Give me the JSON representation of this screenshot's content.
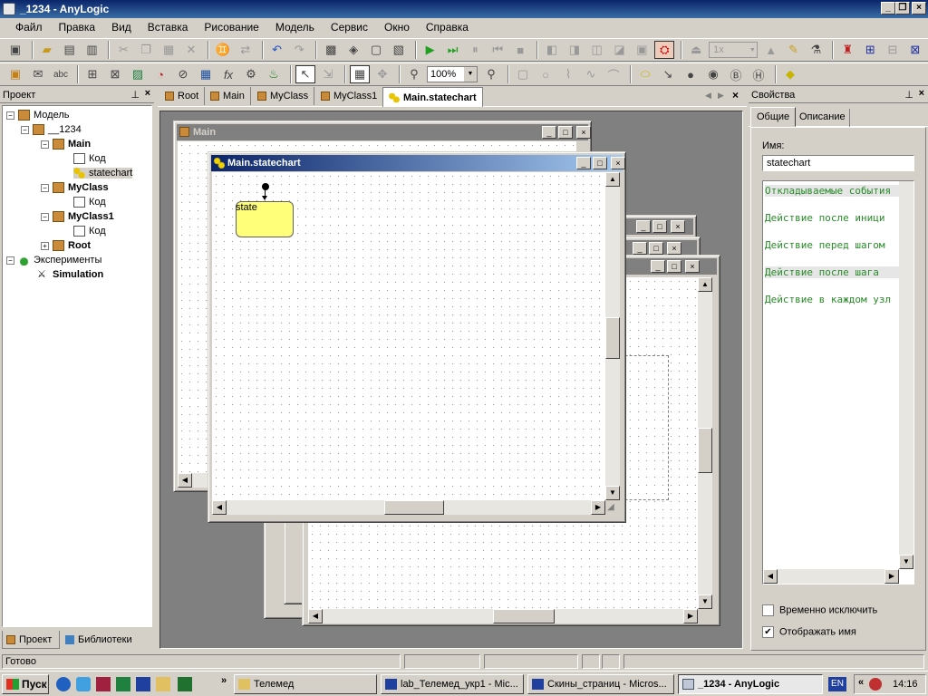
{
  "window": {
    "title": "_1234 - AnyLogic"
  },
  "menu": [
    "Файл",
    "Правка",
    "Вид",
    "Вставка",
    "Рисование",
    "Модель",
    "Сервис",
    "Окно",
    "Справка"
  ],
  "toolbar": {
    "speed": "1x",
    "zoom": "100%"
  },
  "project_panel": {
    "title": "Проект",
    "tree": {
      "model": "Модель",
      "project": "__1234",
      "main": "Main",
      "main_code": "Код",
      "main_statechart": "statechart",
      "myclass": "MyClass",
      "myclass_code": "Код",
      "myclass1": "MyClass1",
      "myclass1_code": "Код",
      "root": "Root",
      "experiments": "Эксперименты",
      "simulation": "Simulation"
    },
    "tabs": {
      "project": "Проект",
      "libraries": "Библиотеки"
    }
  },
  "editor_tabs": [
    "Root",
    "Main",
    "MyClass",
    "MyClass1",
    "Main.statechart"
  ],
  "windows": {
    "main": {
      "title": "Main"
    },
    "statechart": {
      "title": "Main.statechart",
      "state_label": "state"
    }
  },
  "properties": {
    "title": "Свойства",
    "tabs": {
      "general": "Общие",
      "description": "Описание"
    },
    "name_label": "Имя:",
    "name_value": "statechart",
    "actions": [
      "Откладываемые события",
      "Действие после иници",
      "Действие перед шагом",
      "Действие после шага",
      "Действие в каждом узл"
    ],
    "exclude_label": "Временно исключить",
    "exclude_checked": false,
    "show_name_label": "Отображать имя",
    "show_name_checked": true
  },
  "status": {
    "text": "Готово"
  },
  "taskbar": {
    "start": "Пуск",
    "tasks": [
      "Телемед",
      "lab_Телемед_укр1 - Mic...",
      "Скины_страниц - Micros...",
      "_1234 - AnyLogic"
    ],
    "lang": "EN",
    "clock": "14:16"
  }
}
